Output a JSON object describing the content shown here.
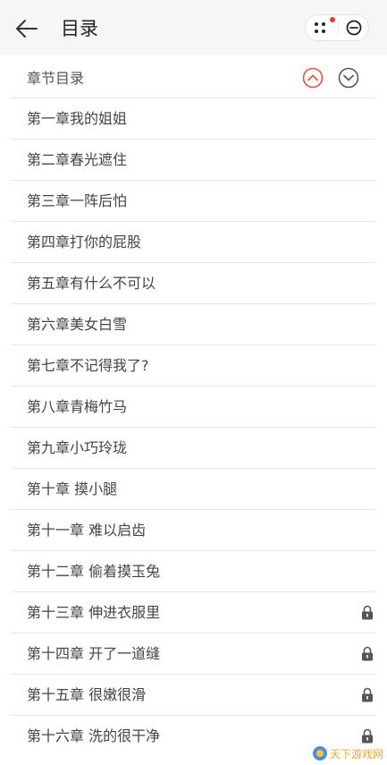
{
  "header": {
    "title": "目录",
    "back_icon": "arrow-left-icon",
    "menu_icon": "more-dots-icon",
    "close_icon": "circle-minus-icon",
    "notification_color": "#e53935"
  },
  "toc": {
    "title": "章节目录",
    "sort_up_icon": "chevron-up-circle-icon",
    "sort_down_icon": "chevron-down-circle-icon",
    "accent_color": "#e0533f"
  },
  "chapters": [
    {
      "title": "第一章我的姐姐",
      "locked": false
    },
    {
      "title": "第二章春光遮住",
      "locked": false
    },
    {
      "title": "第三章一阵后怕",
      "locked": false
    },
    {
      "title": "第四章打你的屁股",
      "locked": false
    },
    {
      "title": "第五章有什么不可以",
      "locked": false
    },
    {
      "title": "第六章美女白雪",
      "locked": false
    },
    {
      "title": "第七章不记得我了?",
      "locked": false
    },
    {
      "title": "第八章青梅竹马",
      "locked": false
    },
    {
      "title": "第九章小巧玲珑",
      "locked": false
    },
    {
      "title": "第十章 摸小腿",
      "locked": false
    },
    {
      "title": "第十一章 难以启齿",
      "locked": false
    },
    {
      "title": "第十二章 偷着摸玉兔",
      "locked": false
    },
    {
      "title": "第十三章 伸进衣服里",
      "locked": true
    },
    {
      "title": "第十四章 开了一道缝",
      "locked": true
    },
    {
      "title": "第十五章 很嫩很滑",
      "locked": true
    },
    {
      "title": "第十六章 洗的很干净",
      "locked": true
    }
  ],
  "watermark": {
    "text": "天下游戏网",
    "color": "#e8a63a"
  }
}
